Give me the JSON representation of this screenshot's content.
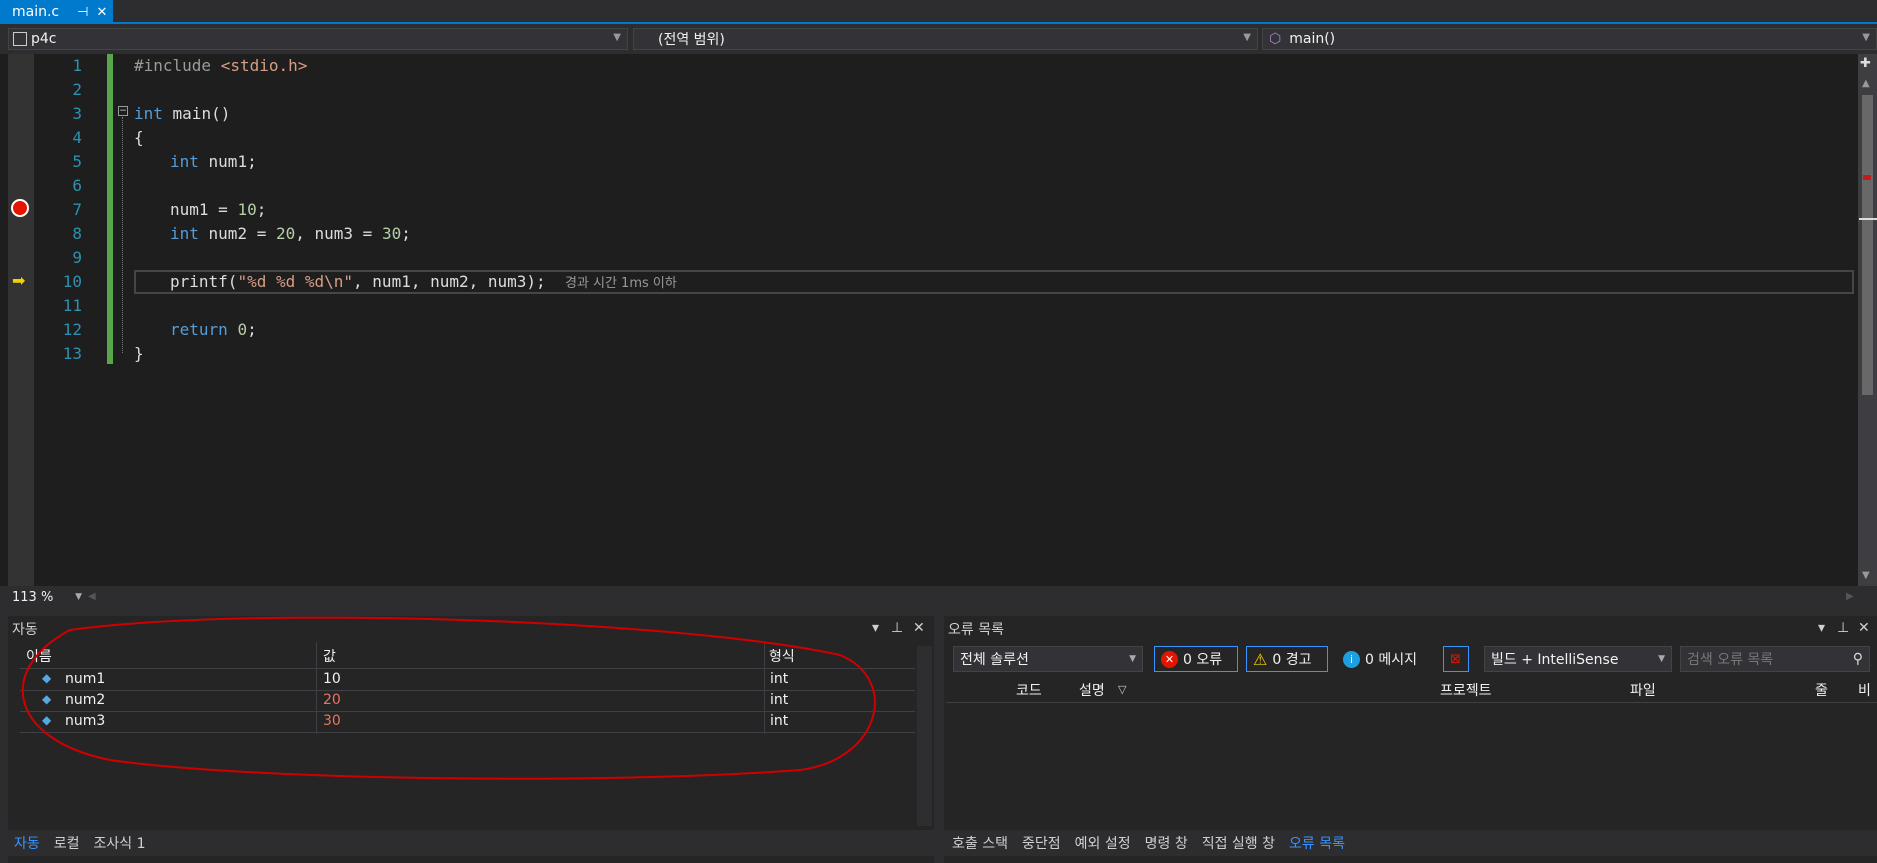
{
  "tab": {
    "title": "main.c",
    "pin_glyph": "⊣",
    "close_glyph": "✕"
  },
  "nav": {
    "project": "p4c",
    "scope": "(전역 범위)",
    "function": "main()"
  },
  "editor": {
    "line_numbers": [
      "1",
      "2",
      "3",
      "4",
      "5",
      "6",
      "7",
      "8",
      "9",
      "10",
      "11",
      "12",
      "13"
    ],
    "perf_tip": "경과 시간 1ms 이하",
    "zoom": "113 %",
    "breakpoint_line": "7",
    "current_line": "10"
  },
  "code": {
    "l1_directive": "#include",
    "l1_header": " <stdio.h>",
    "l3_kw": "int",
    "l3_rest": " main()",
    "l4": "{",
    "l5_kw": "int",
    "l5_rest": " num1;",
    "l7_a": "num1 = ",
    "l7_num": "10",
    "l7_b": ";",
    "l8_kw": "int",
    "l8_a": " num2 = ",
    "l8_n1": "20",
    "l8_b": ", num3 = ",
    "l8_n2": "30",
    "l8_c": ";",
    "l10_a": "printf(",
    "l10_str": "\"%d %d %d\\n\"",
    "l10_b": ", num1, num2, num3);",
    "l12_kw": "return",
    "l12_sp": " ",
    "l12_num": "0",
    "l12_end": ";",
    "l13": "}"
  },
  "autos": {
    "title": "자동",
    "columns": [
      "이름",
      "값",
      "형식"
    ],
    "rows": [
      {
        "name": "num1",
        "value": "10",
        "type": "int",
        "value_color": "#f1f1f1"
      },
      {
        "name": "num2",
        "value": "20",
        "type": "int",
        "value_color": "#e8745c"
      },
      {
        "name": "num3",
        "value": "30",
        "type": "int",
        "value_color": "#e8745c"
      }
    ],
    "tabs": [
      "자동",
      "로컬",
      "조사식 1"
    ]
  },
  "errors": {
    "title": "오류 목록",
    "scope": "전체 솔루션",
    "errors_btn": "0 오류",
    "warnings_btn": "0 경고",
    "messages_btn": "0 메시지",
    "source": "빌드 + IntelliSense",
    "search_placeholder": "검색 오류 목록",
    "columns": [
      "코드",
      "설명",
      "프로젝트",
      "파일",
      "줄",
      "비"
    ],
    "tabs": [
      "호출 스택",
      "중단점",
      "예외 설정",
      "명령 창",
      "직접 실행 창",
      "오류 목록"
    ]
  },
  "colors": {
    "accent": "#007acc",
    "annotation": "#d00000",
    "breakpoint": "#e51400"
  }
}
